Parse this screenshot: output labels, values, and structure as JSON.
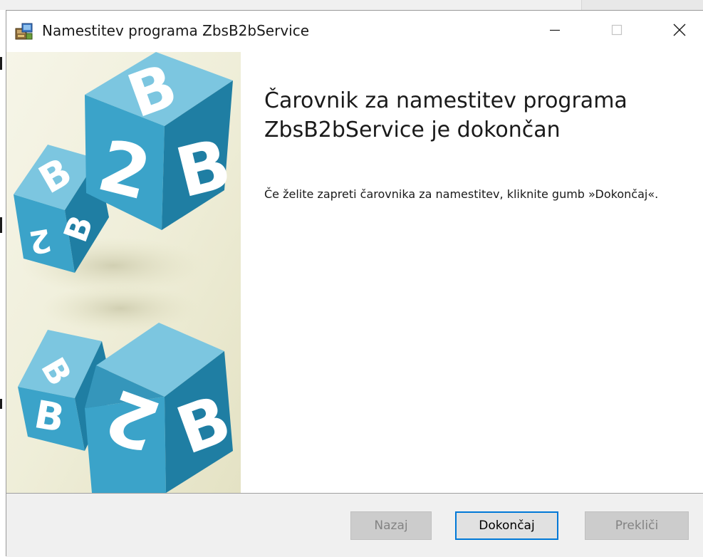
{
  "window": {
    "title": "Namestitev programa ZbsB2bService"
  },
  "main": {
    "heading": "Čarovnik za namestitev programa ZbsB2bService je dokončan",
    "body": "Če želite zapreti čarovnika za namestitev, kliknite gumb »Dokončaj«."
  },
  "buttons": {
    "back_label": "Nazaj",
    "finish_label": "Dokončaj",
    "cancel_label": "Prekliči",
    "back_enabled": false,
    "finish_enabled": true,
    "cancel_enabled": false
  },
  "side_image": {
    "cube_letters": [
      "B",
      "2",
      "B",
      "B",
      "2",
      "B",
      "B",
      "B",
      "2",
      "B"
    ]
  },
  "colors": {
    "accent": "#0078d7",
    "cube_blue": "#3ba3c9",
    "cube_blue_dark": "#1f7ea3",
    "cube_blue_light": "#7cc6e0"
  },
  "icons": {
    "app": "installer-icon",
    "minimize": "minimize-icon",
    "maximize": "maximize-icon",
    "close": "close-icon"
  }
}
